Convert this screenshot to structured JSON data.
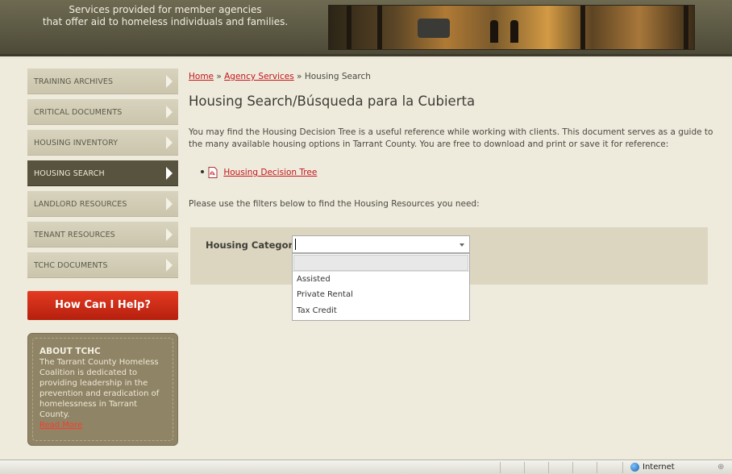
{
  "header": {
    "tagline_line1": "Services provided for member agencies",
    "tagline_line2": "that offer aid to homeless individuals and families."
  },
  "sidebar": {
    "items": [
      {
        "label": "TRAINING ARCHIVES",
        "active": false
      },
      {
        "label": "CRITICAL DOCUMENTS",
        "active": false
      },
      {
        "label": "HOUSING INVENTORY",
        "active": false
      },
      {
        "label": "HOUSING SEARCH",
        "active": true
      },
      {
        "label": "LANDLORD RESOURCES",
        "active": false
      },
      {
        "label": "TENANT RESOURCES",
        "active": false
      },
      {
        "label": "TCHC DOCUMENTS",
        "active": false
      }
    ],
    "help_button": "How Can I Help?",
    "about": {
      "title": "ABOUT TCHC",
      "text": "The Tarrant County Homeless Coalition is dedicated to providing leadership in the prevention and eradication of homelessness in Tarrant County.",
      "link": "Read More"
    }
  },
  "breadcrumb": {
    "home": "Home",
    "sep1": " » ",
    "agency": "Agency Services",
    "sep2": " » ",
    "current": "Housing Search"
  },
  "main": {
    "title": "Housing Search/Búsqueda para la Cubierta",
    "intro": "You may find the Housing Decision Tree is a useful reference while working with clients.  This document serves as a guide to the many available housing options in Tarrant County.  You are free to download and print or save it for reference:",
    "doc_link": "Housing Decision Tree",
    "filter_text": "Please use the filters below to find the Housing Resources you need:",
    "filter": {
      "label": "Housing Category",
      "value": "",
      "options": [
        "",
        "Assisted",
        "Private Rental",
        "Tax Credit"
      ]
    }
  },
  "statusbar": {
    "zone": "Internet"
  },
  "colors": {
    "accent_red": "#c3161c",
    "active_nav": "#58533e",
    "help_button": "#d3301a"
  }
}
